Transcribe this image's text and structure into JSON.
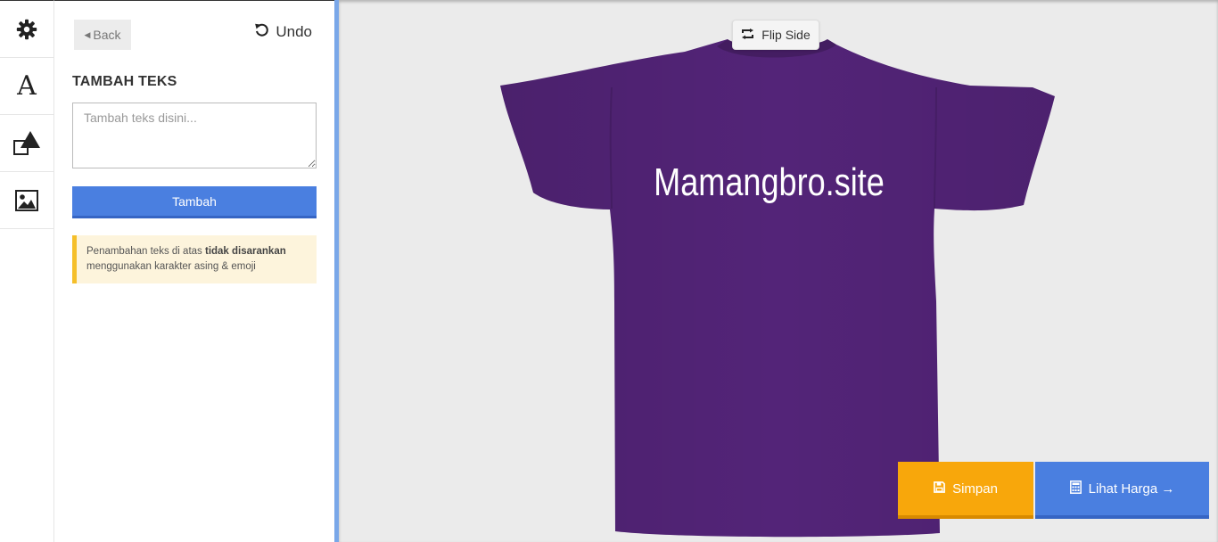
{
  "rail": {
    "items": [
      {
        "icon": "gear-icon"
      },
      {
        "icon": "text-icon",
        "glyph": "A"
      },
      {
        "icon": "shapes-icon"
      },
      {
        "icon": "image-icon"
      }
    ]
  },
  "panel": {
    "back_label": "Back",
    "undo_label": "Undo",
    "title": "TAMBAH TEKS",
    "input_placeholder": "Tambah teks disini...",
    "input_value": "",
    "add_label": "Tambah",
    "notice_before": "Penambahan teks di atas ",
    "notice_bold": "tidak disarankan",
    "notice_after": " menggunakan karakter asing & emoji"
  },
  "stage": {
    "flip_label": "Flip Side",
    "shirt_color": "#532478",
    "shirt_text": "Mamangbro.site"
  },
  "actions": {
    "save_label": "Simpan",
    "price_label": "Lihat Harga →"
  },
  "colors": {
    "accent_blue": "#4a7fe0",
    "save_orange": "#f8a70b",
    "notice_bg": "#fdf4dc",
    "notice_border": "#f5bf2a"
  }
}
